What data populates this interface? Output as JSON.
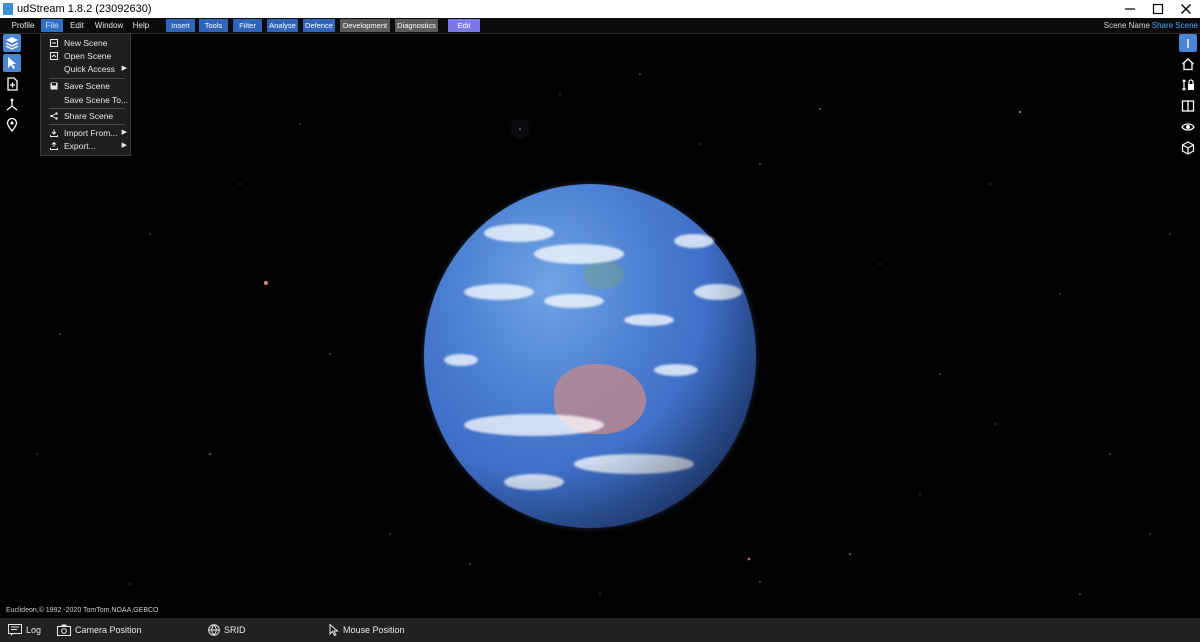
{
  "window": {
    "title": "udStream 1.8.2 (23092630)",
    "controls": [
      "minimize-icon",
      "maximize-icon",
      "close-icon"
    ]
  },
  "menubar": {
    "items": [
      "Profile",
      "File",
      "Edit",
      "Window",
      "Help"
    ],
    "toolbar_tabs": [
      "Insert",
      "Tools",
      "Filter",
      "Analyse",
      "Defence",
      "Development",
      "Diagnostics",
      "Edit"
    ],
    "scene_name_label": "Scene Name",
    "share_scene_label": "Share Scene",
    "colors": {
      "blue_tab": "#2e65b8",
      "gray_tab": "#5a5a5a",
      "edit_tab": "#7a7ae6",
      "share": "#4aa3ff"
    }
  },
  "file_menu": {
    "items": [
      {
        "label": "New Scene",
        "icon": "new-scene-icon"
      },
      {
        "label": "Open Scene",
        "icon": "open-scene-icon"
      },
      {
        "label": "Quick Access",
        "icon": "",
        "submenu": true
      },
      {
        "label": "Save Scene",
        "icon": "save-icon"
      },
      {
        "label": "Save Scene To...",
        "icon": ""
      },
      {
        "label": "Share Scene",
        "icon": "share-icon"
      },
      {
        "label": "Import From...",
        "icon": "import-icon",
        "submenu": true
      },
      {
        "label": "Export...",
        "icon": "export-icon",
        "submenu": true
      }
    ]
  },
  "left_tools": [
    "layers-icon",
    "select-pointer-icon",
    "add-document-icon",
    "gizmo-icon",
    "location-pin-icon"
  ],
  "right_tools": [
    "info-icon",
    "home-icon",
    "height-lock-icon",
    "split-view-icon",
    "visibility-eye-icon",
    "cube-icon"
  ],
  "attribution": "Euclideon,© 1992 -2020 TomTom,NOAA,GEBCO",
  "statusbar": {
    "log": "Log",
    "camera_position": "Camera Position",
    "srid": "SRID",
    "mouse_position": "Mouse Position"
  }
}
